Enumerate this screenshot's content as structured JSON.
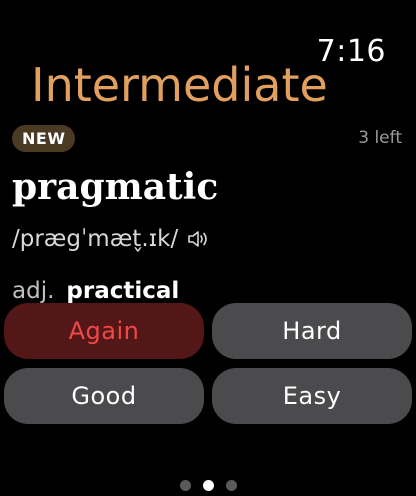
{
  "status": {
    "time": "7:16"
  },
  "deck": {
    "title": "Intermediate"
  },
  "card": {
    "badge": "NEW",
    "remaining": "3 left",
    "word": "pragmatic",
    "pronunciation": "/prægˈmæt̬.ɪk/",
    "part_of_speech": "adj.",
    "meaning": "practical"
  },
  "actions": {
    "again": "Again",
    "hard": "Hard",
    "good": "Good",
    "easy": "Easy"
  },
  "pager": {
    "total": 3,
    "active_index": 1
  },
  "colors": {
    "accent": "#E2A05F",
    "again_bg": "#541717",
    "again_text": "#F04848",
    "button_bg": "#4B4B4D"
  },
  "icons": {
    "speaker": "speaker-icon"
  }
}
